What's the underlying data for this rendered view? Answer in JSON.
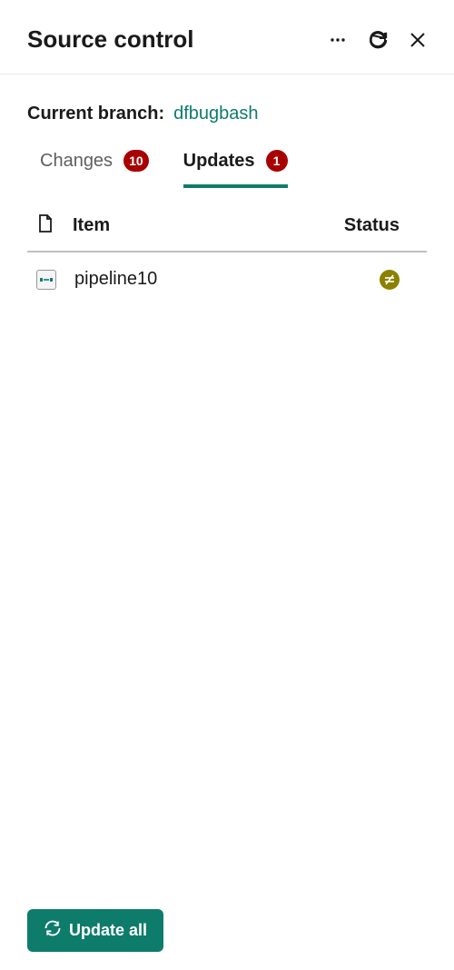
{
  "header": {
    "title": "Source control"
  },
  "branch": {
    "label": "Current branch:",
    "name": "dfbugbash"
  },
  "tabs": {
    "changes": {
      "label": "Changes",
      "count": "10"
    },
    "updates": {
      "label": "Updates",
      "count": "1"
    }
  },
  "table": {
    "headers": {
      "item": "Item",
      "status": "Status"
    },
    "rows": [
      {
        "name": "pipeline10"
      }
    ]
  },
  "footer": {
    "updateAll": "Update all"
  }
}
